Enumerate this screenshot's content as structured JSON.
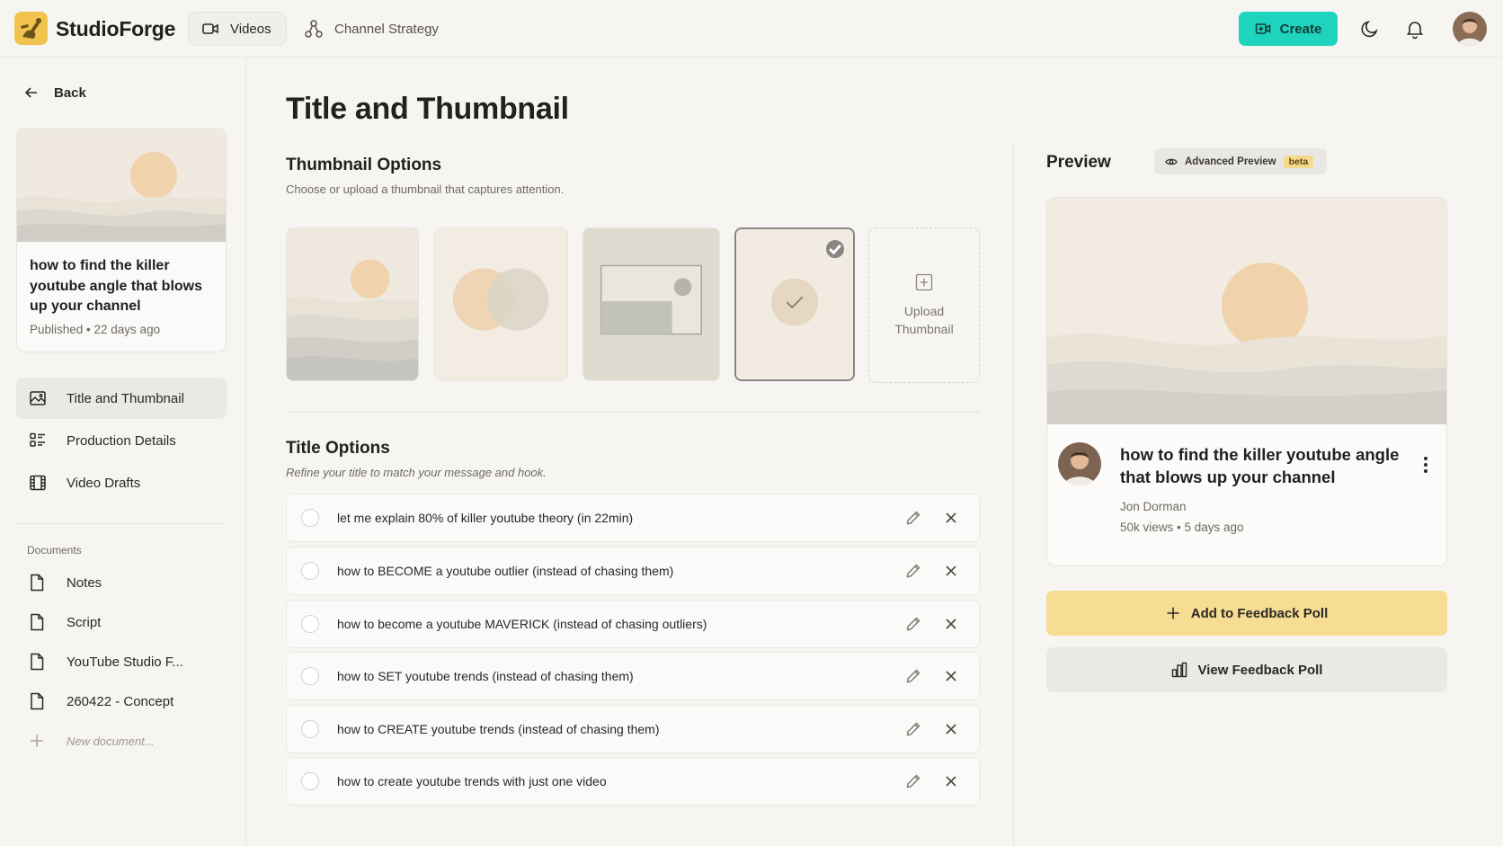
{
  "app": {
    "brand": "StudioForge"
  },
  "topnav": {
    "videos_label": "Videos",
    "strategy_label": "Channel Strategy",
    "create_label": "Create"
  },
  "sidebar": {
    "back_label": "Back",
    "video": {
      "title": "how to find the killer youtube angle that blows up your channel",
      "meta": "Published • 22 days ago"
    },
    "items": [
      {
        "label": "Title and Thumbnail",
        "icon": "image-icon",
        "active": true
      },
      {
        "label": "Production Details",
        "icon": "list-icon"
      },
      {
        "label": "Video Drafts",
        "icon": "film-icon"
      }
    ],
    "documents_label": "Documents",
    "documents": [
      {
        "label": "Notes"
      },
      {
        "label": "Script"
      },
      {
        "label": "YouTube Studio F..."
      },
      {
        "label": "260422 - Concept"
      }
    ],
    "new_document_label": "New document..."
  },
  "main": {
    "page_title": "Title and Thumbnail",
    "thumbnails": {
      "heading": "Thumbnail Options",
      "subtitle": "Choose or upload a thumbnail that captures attention.",
      "selected_index": 3,
      "upload_label": "Upload Thumbnail"
    },
    "titles": {
      "heading": "Title Options",
      "subtitle": "Refine your title to match your message and hook.",
      "options": [
        "let me explain 80% of killer youtube theory (in 22min)",
        "how to BECOME a youtube outlier (instead of chasing them)",
        "how to become a youtube MAVERICK (instead of chasing outliers)",
        "how to SET youtube trends (instead of chasing them)",
        "how to CREATE youtube trends (instead of chasing them)",
        "how to create youtube trends with just one video"
      ]
    }
  },
  "preview": {
    "heading": "Preview",
    "advanced_label": "Advanced Preview",
    "beta_label": "beta",
    "card": {
      "title": "how to find the killer youtube angle that blows up your channel",
      "author": "Jon Dorman",
      "meta": "50k views • 5 days ago"
    },
    "add_poll_label": "Add to Feedback Poll",
    "view_poll_label": "View Feedback Poll"
  },
  "colors": {
    "accent_create": "#1fd4be",
    "poll_button": "#f7dc93",
    "background": "#f7f5f2"
  }
}
